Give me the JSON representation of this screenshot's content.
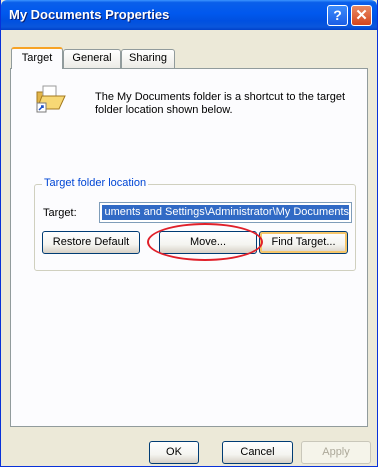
{
  "window": {
    "title": "My Documents Properties"
  },
  "title_buttons": {
    "help": "?",
    "close": "✕"
  },
  "tabs": [
    {
      "label": "Target",
      "active": true
    },
    {
      "label": "General",
      "active": false
    },
    {
      "label": "Sharing",
      "active": false
    }
  ],
  "target_tab": {
    "icon": "folder-shortcut-icon",
    "description": "The My Documents folder is a shortcut to the target folder location shown below.",
    "group_label": "Target folder location",
    "target_label": "Target:",
    "target_value": "C:\\Documents and Settings\\Administrator\\My Documents",
    "target_value_visible": "uments and Settings\\Administrator\\My Documents",
    "restore_default_label": "Restore Default",
    "move_label": "Move...",
    "find_target_label": "Find Target..."
  },
  "footer": {
    "ok_label": "OK",
    "cancel_label": "Cancel",
    "apply_label": "Apply"
  },
  "colors": {
    "titlebar": "#0058ee",
    "group_label": "#0046d5",
    "selection": "#316ac5",
    "annotation": "#e0202a"
  }
}
